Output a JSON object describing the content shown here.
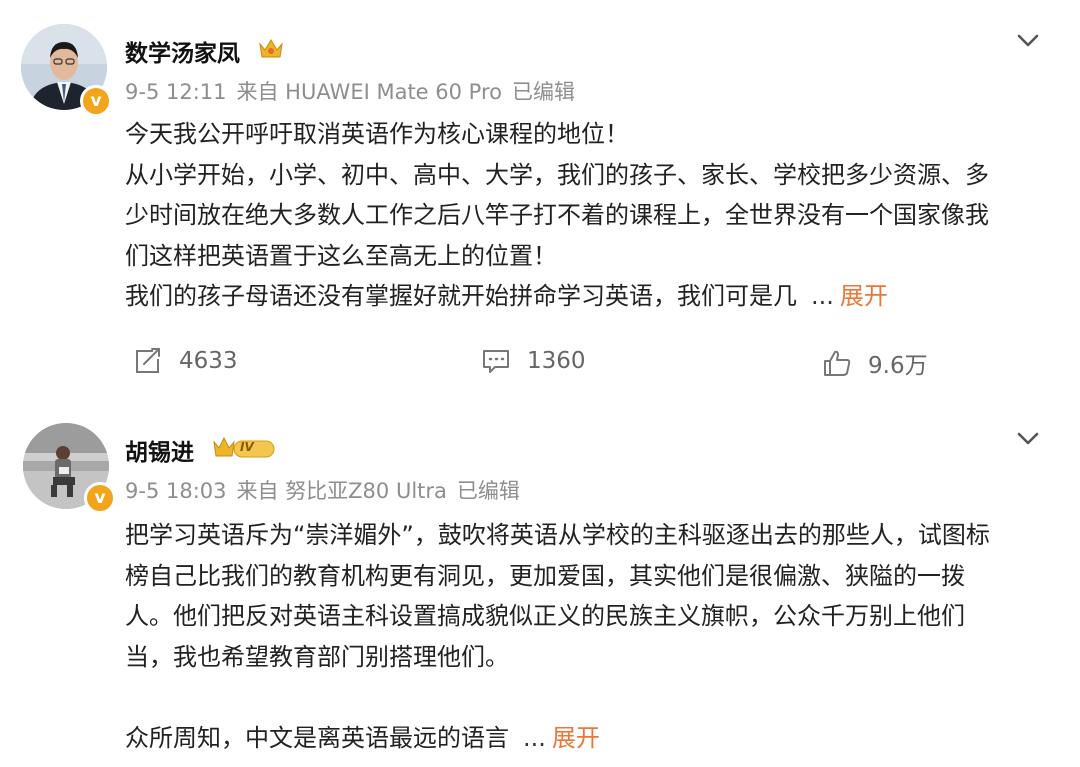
{
  "posts": [
    {
      "author": "数学汤家凤",
      "time": "9-5 12:11",
      "source": "来自 HUAWEI Mate 60 Pro",
      "edited": "已编辑",
      "paragraphs": [
        "今天我公开呼吁取消英语作为核心课程的地位！",
        "从小学开始，小学、初中、高中、大学，我们的孩子、家长、学校把多少资源、多",
        "少时间放在绝大多数人工作之后八竿子打不着的课程上，全世界没有一个国家像我",
        "们这样把英语置于这么至高无上的位置！",
        "我们的孩子母语还没有掌握好就开始拼命学习英语，我们可是几"
      ],
      "ellipsis": "...",
      "expand_label": "展开",
      "repost_count": "4633",
      "comment_count": "1360",
      "like_count": "9.6万"
    },
    {
      "author": "胡锡进",
      "level_badge": "IV",
      "time": "9-5 18:03",
      "source": "来自 努比亚Z80 Ultra",
      "edited": "已编辑",
      "paragraphs": [
        "把学习英语斥为“崇洋媚外”，鼓吹将英语从学校的主科驱逐出去的那些人，试图标",
        "榜自己比我们的教育机构更有洞见，更加爱国，其实他们是很偏激、狭隘的一拨",
        "人。他们把反对英语主科设置搞成貌似正义的民族主义旗帜，公众千万别上他们",
        "当，我也希望教育部门别搭理他们。",
        "",
        "众所周知，中文是离英语最远的语言"
      ],
      "ellipsis": "...",
      "expand_label": "展开"
    }
  ],
  "colors": {
    "expand": "#e9773a",
    "meta": "#8e8e8e",
    "verified_badge": "#f2a51a"
  }
}
